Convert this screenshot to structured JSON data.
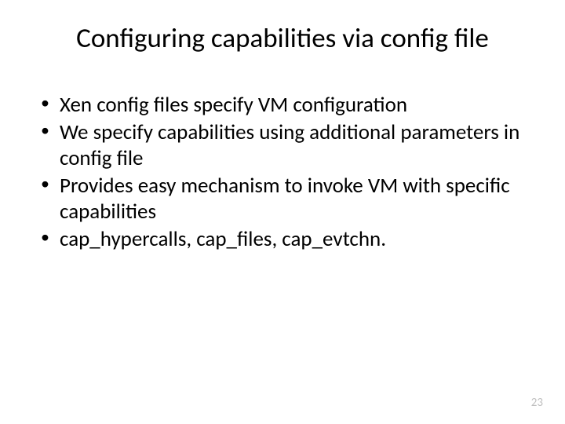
{
  "slide": {
    "title": "Configuring capabilities via config file",
    "bullets": [
      "Xen config files specify VM configuration",
      "We specify capabilities using additional parameters in config file",
      "Provides easy mechanism to invoke VM with specific capabilities",
      "cap_hypercalls, cap_files, cap_evtchn."
    ],
    "page_number": "23"
  }
}
